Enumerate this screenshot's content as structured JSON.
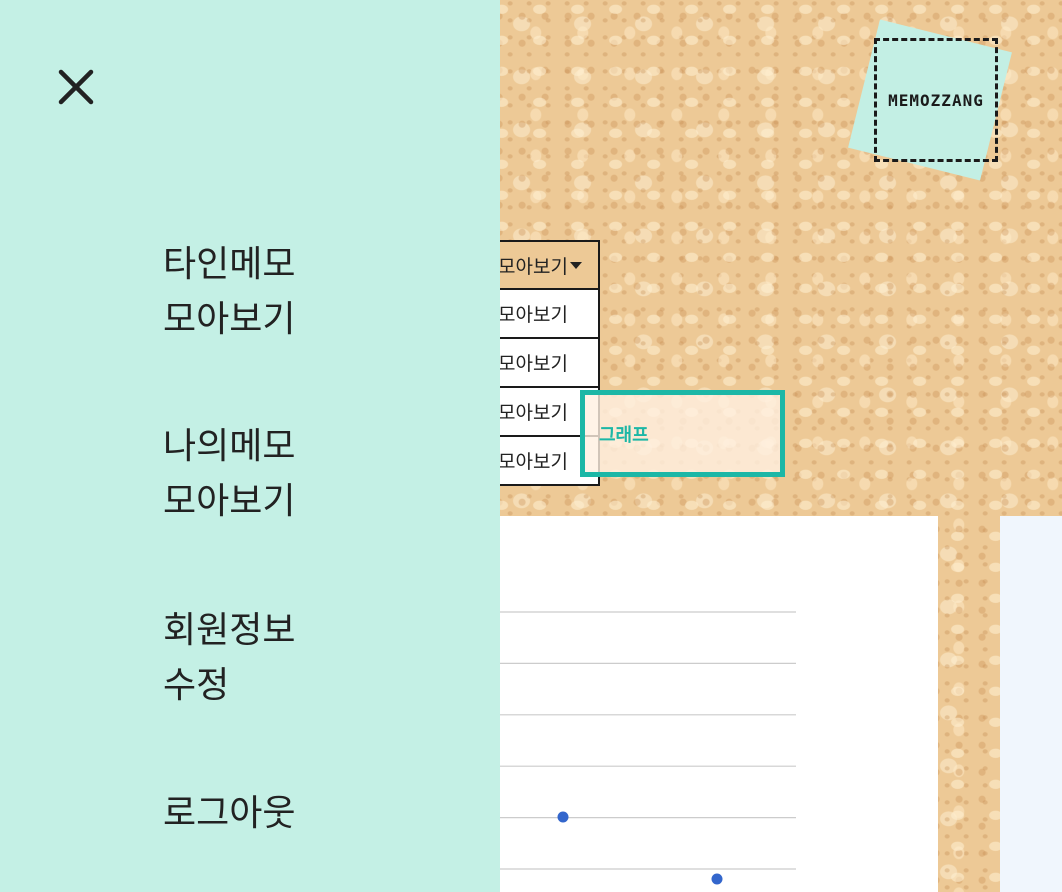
{
  "logo": {
    "text": "MEMOZZANG"
  },
  "dropdown": {
    "selected": "모아보기",
    "options": [
      "모아보기",
      "모아보기",
      "모아보기",
      "모아보기"
    ]
  },
  "graph_button": {
    "label": "그래프"
  },
  "chart_data": {
    "type": "scatter",
    "title": "",
    "xlabel": "",
    "ylabel": "",
    "x": [
      1,
      2
    ],
    "y": [
      1,
      0
    ],
    "gridlines": 6,
    "grid": true
  },
  "side_menu": {
    "close_icon": "close-icon",
    "items": [
      {
        "line1": "타인메모",
        "line2": "모아보기"
      },
      {
        "line1": "나의메모",
        "line2": "모아보기"
      },
      {
        "line1": "회원정보",
        "line2": "수정"
      },
      {
        "line1": "로그아웃",
        "line2": ""
      }
    ]
  },
  "colors": {
    "overlay": "#c4f0e5",
    "accent": "#1cb7a6",
    "point": "#3366cc"
  }
}
